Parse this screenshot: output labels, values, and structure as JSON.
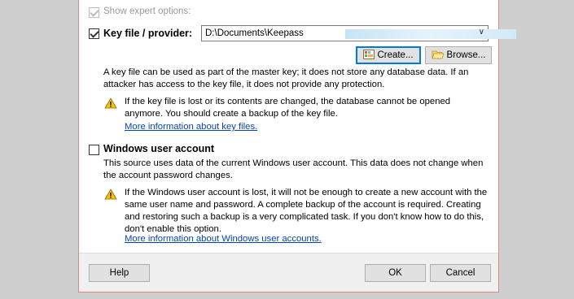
{
  "expert_options": {
    "label": "Show expert options:",
    "checked": true,
    "enabled": false
  },
  "key_file": {
    "label": "Key file / provider:",
    "checked": true,
    "path_value": "D:\\Documents\\Keepass",
    "create_label": "Create...",
    "browse_label": "Browse...",
    "description": "A key file can be used as part of the master key; it does not store any database data. If an attacker has access to the key file, it does not provide any protection.",
    "warning": "If the key file is lost or its contents are changed, the database cannot be opened anymore. You should create a backup of the key file.",
    "link": "More information about key files."
  },
  "windows_account": {
    "label": "Windows user account",
    "checked": false,
    "description": "This source uses data of the current Windows user account. This data does not change when the account password changes.",
    "warning": "If the Windows user account is lost, it will not be enough to create a new account with the same user name and password. A complete backup of the account is required. Creating and restoring such a backup is a very complicated task. If you don't know how to do this, don't enable this option.",
    "link": "More information about Windows user accounts."
  },
  "footer": {
    "help_label": "Help",
    "ok_label": "OK",
    "cancel_label": "Cancel"
  },
  "colors": {
    "link": "#0645ad",
    "default_button_border": "#0078d7",
    "footer_bg": "#f0f0f0",
    "warning_yellow": "#f5c400"
  }
}
